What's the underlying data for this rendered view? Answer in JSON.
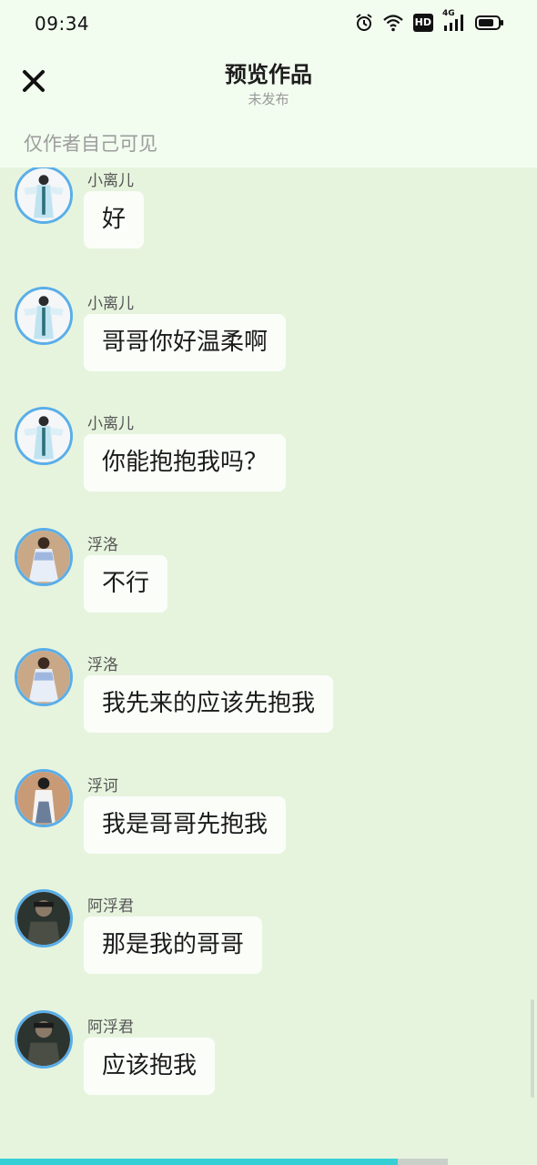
{
  "status_bar": {
    "time": "09:34",
    "icons": [
      "alarm-icon",
      "wifi-icon",
      "hd-icon",
      "4g-signal-icon",
      "battery-icon"
    ],
    "hd_label": "HD",
    "network_label": "4G"
  },
  "header": {
    "title": "预览作品",
    "subtitle": "未发布",
    "visibility_note": "仅作者自己可见",
    "close_icon": "close-icon"
  },
  "messages": [
    {
      "sender": "小离儿",
      "text": "好",
      "avatar": "avatar-xiaoli"
    },
    {
      "sender": "小离儿",
      "text": "哥哥你好温柔啊",
      "avatar": "avatar-xiaoli"
    },
    {
      "sender": "小离儿",
      "text": "你能抱抱我吗？",
      "avatar": "avatar-xiaoli"
    },
    {
      "sender": "浮洛",
      "text": "不行",
      "avatar": "avatar-fuluo"
    },
    {
      "sender": "浮洛",
      "text": "我先来的应该先抱我",
      "avatar": "avatar-fuluo"
    },
    {
      "sender": "浮诃",
      "text": "我是哥哥先抱我",
      "avatar": "avatar-fuhe"
    },
    {
      "sender": "阿浮君",
      "text": "那是我的哥哥",
      "avatar": "avatar-afujun"
    },
    {
      "sender": "阿浮君",
      "text": "应该抱我",
      "avatar": "avatar-afujun"
    }
  ],
  "colors": {
    "background": "#e6f4de",
    "header_bg": "#f2fcef",
    "avatar_border": "#5aaee8",
    "bubble_bg": "#fbfdf9",
    "progress_accent": "#35d0d6"
  },
  "progress": 0.74
}
